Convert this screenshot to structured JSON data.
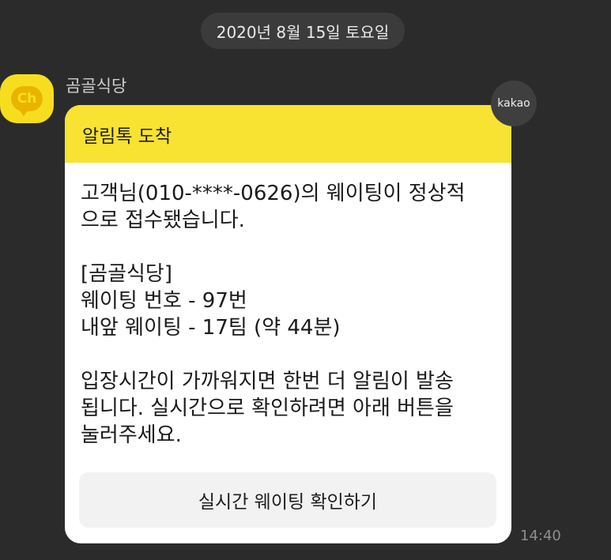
{
  "date_divider": "2020년 8월 15일 토요일",
  "sender": {
    "name": "곰골식당",
    "avatar_text": "Ch"
  },
  "badge": "kakao",
  "message": {
    "header": "알림톡 도착",
    "lines_a": [
      "고객님(010-****-0626)의 웨이팅이 정상적",
      "으로 접수됐습니다."
    ],
    "lines_b": [
      "[곰골식당]",
      "웨이팅 번호 - 97번",
      "내앞 웨이팅 - 17팀 (약 44분)"
    ],
    "lines_c": [
      "입장시간이 가까워지면 한번 더 알림이 발송",
      "됩니다. 실시간으로 확인하려면 아래 버튼을",
      "눌러주세요."
    ],
    "button_label": "실시간 웨이팅 확인하기",
    "time": "14:40"
  }
}
